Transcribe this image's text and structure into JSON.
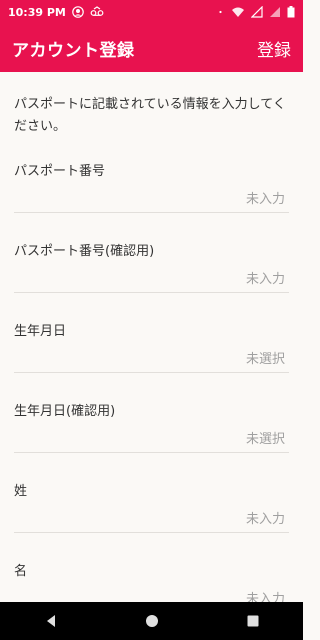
{
  "status_bar": {
    "time": "10:39 PM",
    "icons": [
      "avatar-icon",
      "voicemail-icon",
      "dot-icon",
      "wifi-icon",
      "signal-icon",
      "battery-icon"
    ]
  },
  "app_bar": {
    "title": "アカウント登録",
    "register_label": "登録",
    "color": "#e8124f"
  },
  "intro_text": "パスポートに記載されている情報を入力してください。",
  "fields": [
    {
      "label": "パスポート番号",
      "placeholder": "未入力"
    },
    {
      "label": "パスポート番号(確認用)",
      "placeholder": "未入力"
    },
    {
      "label": "生年月日",
      "placeholder": "未選択"
    },
    {
      "label": "生年月日(確認用)",
      "placeholder": "未選択"
    },
    {
      "label": "姓",
      "placeholder": "未入力"
    },
    {
      "label": "名",
      "placeholder": "未入力"
    }
  ],
  "nav_bar": {
    "buttons": [
      "back-icon",
      "home-icon",
      "recents-icon"
    ]
  }
}
